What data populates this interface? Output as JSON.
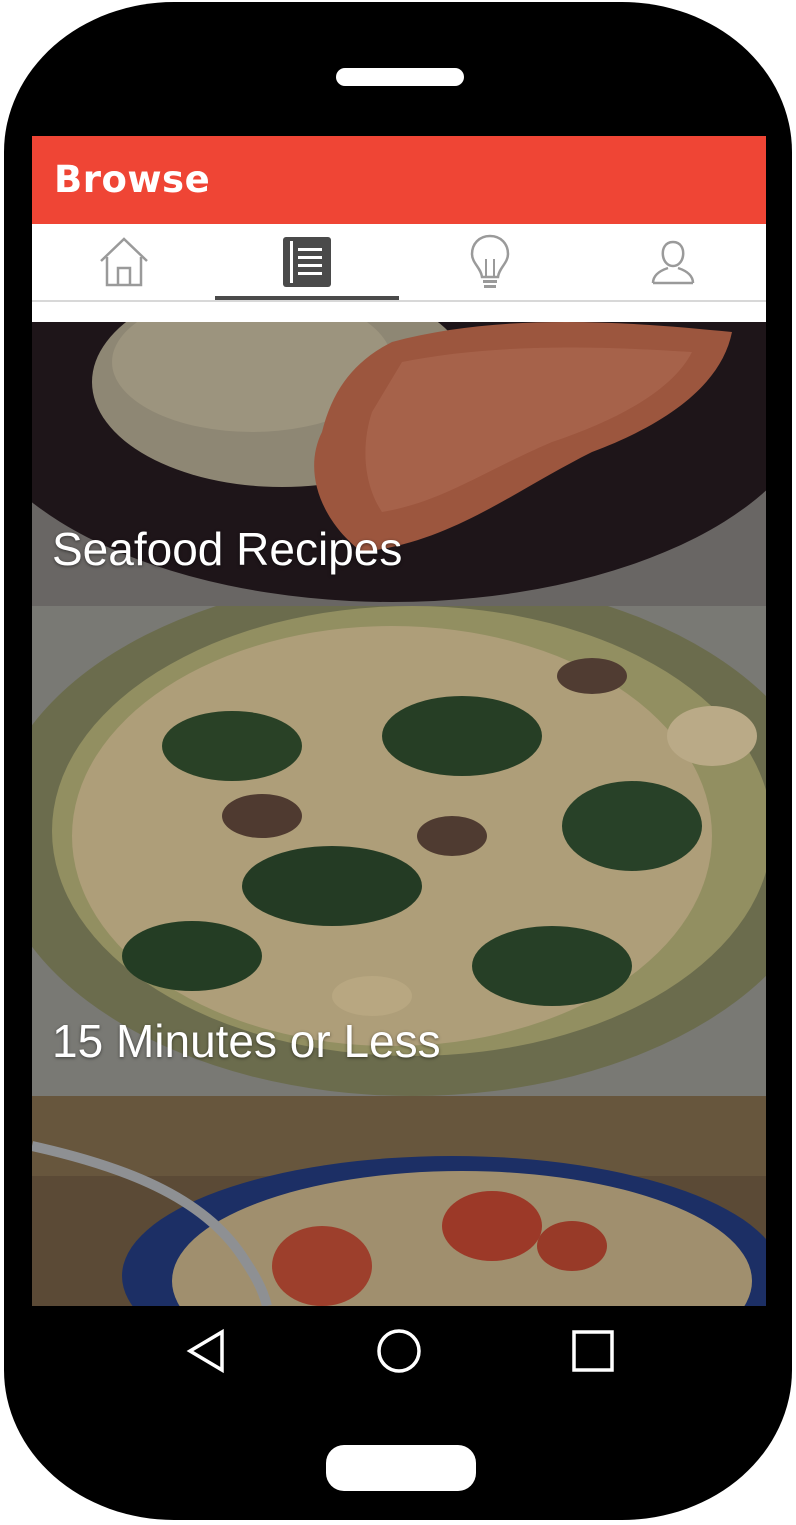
{
  "app": {
    "title": "Browse",
    "accent_color": "#ef4535"
  },
  "tabs": [
    {
      "name": "home",
      "icon": "home-icon"
    },
    {
      "name": "browse",
      "icon": "list-icon",
      "selected": true
    },
    {
      "name": "ideas",
      "icon": "lightbulb-icon"
    },
    {
      "name": "profile",
      "icon": "user-icon"
    }
  ],
  "cards": [
    {
      "title": "Seafood Recipes"
    },
    {
      "title": "15 Minutes or Less"
    },
    {
      "title": ""
    }
  ],
  "system_nav": [
    "back-icon",
    "home-circle-icon",
    "recents-icon"
  ]
}
